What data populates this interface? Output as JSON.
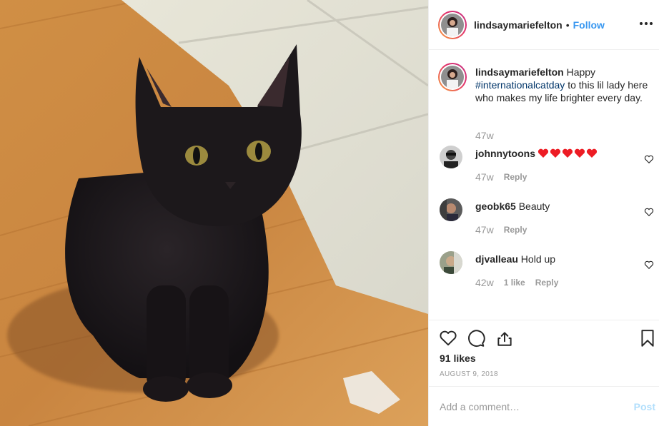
{
  "post": {
    "author": "lindsaymariefelton",
    "dot": "•",
    "follow_label": "Follow",
    "more_label": "···",
    "image_subject": "black cat sitting on wooden floor",
    "caption": {
      "username": "lindsaymariefelton",
      "text_before": " Happy ",
      "hashtag": "#internationalcatday",
      "text_after": " to this lil lady here who makes my life brighter every day.",
      "time": "47w"
    },
    "comments": [
      {
        "username": "johnnytoons",
        "text": "",
        "hearts": 5,
        "time": "47w",
        "likes": "",
        "reply_label": "Reply"
      },
      {
        "username": "geobk65",
        "text": " Beauty",
        "hearts": 0,
        "time": "47w",
        "likes": "",
        "reply_label": "Reply"
      },
      {
        "username": "djvalleau",
        "text": " Hold up",
        "hearts": 0,
        "time": "42w",
        "likes": "1 like",
        "reply_label": "Reply"
      }
    ],
    "likes_count": "91 likes",
    "date": "AUGUST 9, 2018",
    "add_comment_placeholder": "Add a comment…",
    "post_label": "Post",
    "colors": {
      "link": "#3897f0",
      "hashtag": "#003569",
      "heart_red": "#ed4956",
      "muted": "#999999",
      "post_disabled": "#b2dffc"
    },
    "icons": [
      "heart-icon",
      "comment-icon",
      "share-icon",
      "bookmark-icon",
      "more-options-icon"
    ]
  }
}
